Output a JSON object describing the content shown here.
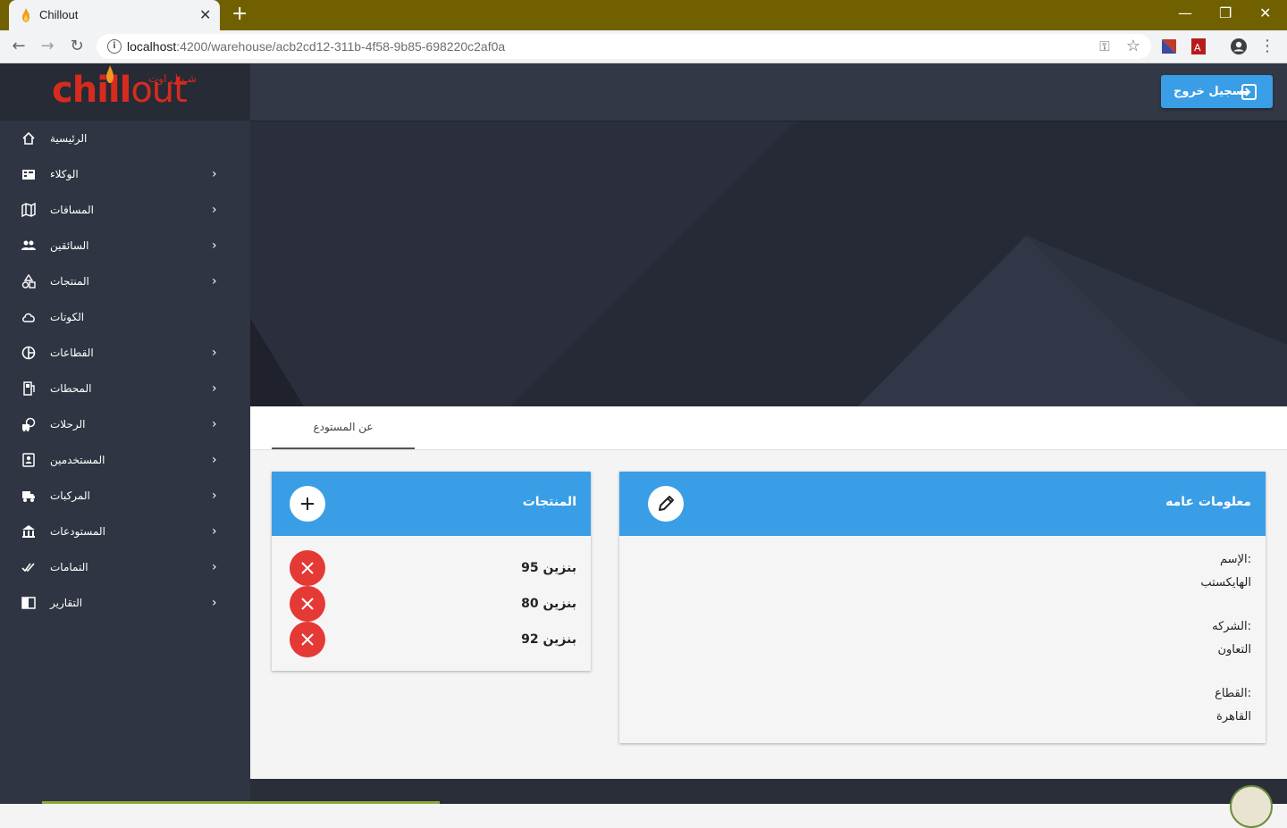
{
  "browser": {
    "tab_title": "Chillout",
    "url_host": "localhost",
    "url_path": ":4200/warehouse/acb2cd12-311b-4f58-9b85-698220c2af0a"
  },
  "brand": {
    "logo_text_chill": "chill",
    "logo_text_out": "out",
    "logo_arabic": "شـيـل اوت"
  },
  "sidebar": {
    "items": [
      {
        "label": "الرئيسية",
        "icon": "home-icon",
        "has_children": false
      },
      {
        "label": "الوكلاء",
        "icon": "agents-icon",
        "has_children": true
      },
      {
        "label": "المسافات",
        "icon": "map-icon",
        "has_children": true
      },
      {
        "label": "السائقين",
        "icon": "people-icon",
        "has_children": true
      },
      {
        "label": "المنتجات",
        "icon": "shapes-icon",
        "has_children": true
      },
      {
        "label": "الكوتات",
        "icon": "cloud-icon",
        "has_children": false
      },
      {
        "label": "القطاعات",
        "icon": "pie-icon",
        "has_children": true
      },
      {
        "label": "المحطات",
        "icon": "station-icon",
        "has_children": true
      },
      {
        "label": "الرحلات",
        "icon": "trips-icon",
        "has_children": true
      },
      {
        "label": "المستخدمين",
        "icon": "user-badge-icon",
        "has_children": true
      },
      {
        "label": "المركبات",
        "icon": "truck-icon",
        "has_children": true
      },
      {
        "label": "المستودعات",
        "icon": "bank-icon",
        "has_children": true
      },
      {
        "label": "التمامات",
        "icon": "check-all-icon",
        "has_children": true
      },
      {
        "label": "التقارير",
        "icon": "book-icon",
        "has_children": true
      }
    ]
  },
  "header": {
    "logout_label": "تسجيل خروج"
  },
  "tabs": [
    {
      "label": "عن المستودع",
      "active": true
    }
  ],
  "products_card": {
    "title": "المنتجات",
    "items": [
      "بنزين 95",
      "بنزين 80",
      "بنزين 92"
    ]
  },
  "info_card": {
    "title": "معلومات عامه",
    "fields": [
      {
        "label": "الإسم:",
        "value": "الهايكستب"
      },
      {
        "label": "الشركه:",
        "value": "التعاون"
      },
      {
        "label": "القطاع:",
        "value": "القاهرة"
      }
    ]
  },
  "colors": {
    "accent": "#3a9ee6",
    "sidebar": "#2f3542",
    "danger": "#e53935",
    "brand_red": "#d62b1e"
  }
}
